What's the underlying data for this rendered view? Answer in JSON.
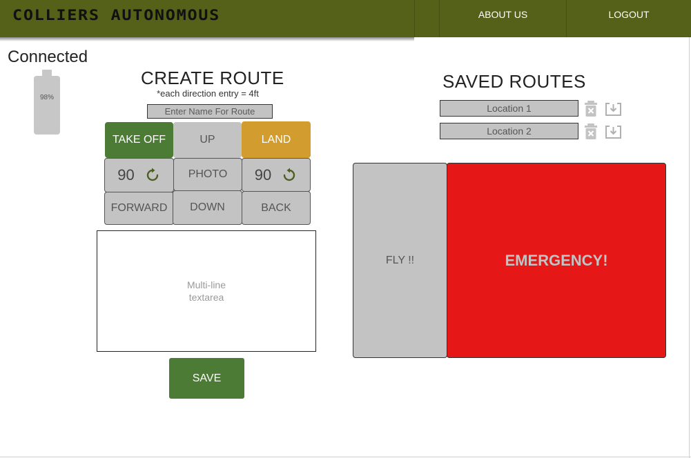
{
  "header": {
    "logo": "COLLIERS AUTONOMOUS",
    "nav": {
      "about": "ABOUT US",
      "logout": "LOGOUT"
    }
  },
  "status": {
    "connection": "Connected",
    "battery_label": "98%",
    "battery_level": 0.98
  },
  "create_route": {
    "title": "CREATE ROUTE",
    "note": "*each direction entry = 4ft",
    "name_placeholder": "Enter Name For Route",
    "buttons": {
      "take_off": "TAKE OFF",
      "up": "UP",
      "land": "LAND",
      "rotate_left_value": "90",
      "rotate_left_icon": "rotate-clockwise-icon",
      "photo": "PHOTO",
      "rotate_right_value": "90",
      "rotate_right_icon": "rotate-counterclockwise-icon",
      "forward": "FORWARD",
      "down": "DOWN",
      "back": "BACK"
    },
    "textarea_placeholder": "Multi-line\ntextarea",
    "save": "SAVE"
  },
  "saved_routes": {
    "title": "SAVED ROUTES",
    "routes": [
      {
        "name": "Location 1",
        "delete_icon": "trash-icon",
        "load_icon": "download-icon"
      },
      {
        "name": "Location 2",
        "delete_icon": "trash-icon",
        "load_icon": "download-icon"
      }
    ]
  },
  "controls": {
    "fly": "FLY !!",
    "emergency": "EMERGENCY!"
  },
  "colors": {
    "header_bg": "#556018",
    "green": "#4b7b34",
    "gold": "#d29c2f",
    "gray": "#c3c3c3",
    "emergency": "#e51717"
  }
}
